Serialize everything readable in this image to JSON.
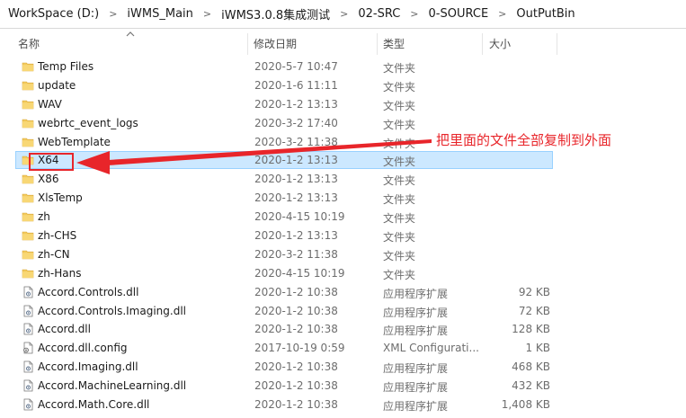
{
  "breadcrumb": [
    "WorkSpace (D:)",
    "iWMS_Main",
    "iWMS3.0.8集成测试",
    "02-SRC",
    "0-SOURCE",
    "OutPutBin"
  ],
  "columns": {
    "name": "名称",
    "date": "修改日期",
    "type": "类型",
    "size": "大小"
  },
  "files": [
    {
      "name": "Temp Files",
      "date": "2020-5-7 10:47",
      "type": "文件夹",
      "size": "",
      "icon": "folder-icon"
    },
    {
      "name": "update",
      "date": "2020-1-6 11:11",
      "type": "文件夹",
      "size": "",
      "icon": "folder-icon"
    },
    {
      "name": "WAV",
      "date": "2020-1-2 13:13",
      "type": "文件夹",
      "size": "",
      "icon": "folder-icon"
    },
    {
      "name": "webrtc_event_logs",
      "date": "2020-3-2 17:40",
      "type": "文件夹",
      "size": "",
      "icon": "folder-icon"
    },
    {
      "name": "WebTemplate",
      "date": "2020-3-2 11:38",
      "type": "文件夹",
      "size": "",
      "icon": "folder-icon"
    },
    {
      "name": "X64",
      "date": "2020-1-2 13:13",
      "type": "文件夹",
      "size": "",
      "icon": "folder-icon",
      "selected": true
    },
    {
      "name": "X86",
      "date": "2020-1-2 13:13",
      "type": "文件夹",
      "size": "",
      "icon": "folder-icon"
    },
    {
      "name": "XlsTemp",
      "date": "2020-1-2 13:13",
      "type": "文件夹",
      "size": "",
      "icon": "folder-icon"
    },
    {
      "name": "zh",
      "date": "2020-4-15 10:19",
      "type": "文件夹",
      "size": "",
      "icon": "folder-icon"
    },
    {
      "name": "zh-CHS",
      "date": "2020-1-2 13:13",
      "type": "文件夹",
      "size": "",
      "icon": "folder-icon"
    },
    {
      "name": "zh-CN",
      "date": "2020-3-2 11:38",
      "type": "文件夹",
      "size": "",
      "icon": "folder-icon"
    },
    {
      "name": "zh-Hans",
      "date": "2020-4-15 10:19",
      "type": "文件夹",
      "size": "",
      "icon": "folder-icon"
    },
    {
      "name": "Accord.Controls.dll",
      "date": "2020-1-2 10:38",
      "type": "应用程序扩展",
      "size": "92 KB",
      "icon": "dll-file-icon"
    },
    {
      "name": "Accord.Controls.Imaging.dll",
      "date": "2020-1-2 10:38",
      "type": "应用程序扩展",
      "size": "72 KB",
      "icon": "dll-file-icon"
    },
    {
      "name": "Accord.dll",
      "date": "2020-1-2 10:38",
      "type": "应用程序扩展",
      "size": "128 KB",
      "icon": "dll-file-icon"
    },
    {
      "name": "Accord.dll.config",
      "date": "2017-10-19 0:59",
      "type": "XML Configurati...",
      "size": "1 KB",
      "icon": "config-file-icon"
    },
    {
      "name": "Accord.Imaging.dll",
      "date": "2020-1-2 10:38",
      "type": "应用程序扩展",
      "size": "468 KB",
      "icon": "dll-file-icon"
    },
    {
      "name": "Accord.MachineLearning.dll",
      "date": "2020-1-2 10:38",
      "type": "应用程序扩展",
      "size": "432 KB",
      "icon": "dll-file-icon"
    },
    {
      "name": "Accord.Math.Core.dll",
      "date": "2020-1-2 10:38",
      "type": "应用程序扩展",
      "size": "1,408 KB",
      "icon": "dll-file-icon"
    }
  ],
  "annotation": {
    "text": "把里面的文件全部复制到外面"
  },
  "colors": {
    "annotation": "#e8252a",
    "selection": "#cce8ff",
    "folder": "#f2c95c"
  }
}
